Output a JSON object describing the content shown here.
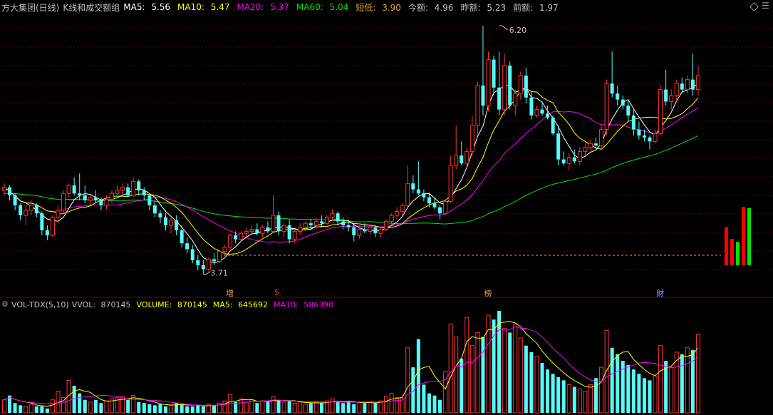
{
  "colors": {
    "up": "#ff3232",
    "down": "#54fcfc",
    "ma5": "#ffffff",
    "ma10": "#ffff00",
    "ma20": "#ff00ff",
    "ma60": "#00e600",
    "text": "#c0c0c0",
    "grid": "#800000",
    "low_line": "#c8a07a",
    "accent_orange": "#e0a040",
    "accent_blue": "#7aa2ff"
  },
  "header": {
    "stock_name": "方大集团(日线)",
    "indicator_name": "K线和成交额组",
    "ma5_label": "MA5:",
    "ma5_value": "5.56",
    "ma10_label": "MA10:",
    "ma10_value": "5.47",
    "ma20_label": "MA20:",
    "ma20_value": "5.37",
    "ma60_label": "MA60:",
    "ma60_value": "5.04",
    "short_low_label": "短低:",
    "short_low_value": "3.90",
    "today_amount_label": "今额:",
    "today_amount_value": "4.96",
    "yesterday_amount_label": "昨额:",
    "yesterday_amount_value": "5.23",
    "prev_amount_label": "前额:",
    "prev_amount_value": "1.97"
  },
  "volume_header": {
    "indicator": "VOL-TDX(5,10)",
    "vvol_label": "VVOL:",
    "vvol_value": "870145",
    "volume_label": "VOLUME:",
    "volume_value": "870145",
    "ma5_label": "MA5:",
    "ma5_value": "645692",
    "ma10_label": "MA10:",
    "ma10_value": "586390"
  },
  "annotations": {
    "high_label": "6.20",
    "low_label": "3.71",
    "event_markers": [
      {
        "label": "增",
        "index": 42,
        "color": "#e0a040"
      },
      {
        "label": "$",
        "index": 51,
        "color": "#ff3232"
      },
      {
        "label": "榜",
        "index": 90,
        "color": "#e0a040"
      },
      {
        "label": "财",
        "index": 122,
        "color": "#7aa2ff"
      }
    ]
  },
  "chart_data": {
    "type": "candlestick",
    "price_range": [
      3.6,
      6.3
    ],
    "low_reference": 3.9,
    "high_point": {
      "index": 92,
      "value": 6.2
    },
    "low_point": {
      "index": 37,
      "value": 3.71
    },
    "ohlc": [
      [
        4.55,
        4.62,
        4.5,
        4.58
      ],
      [
        4.58,
        4.6,
        4.45,
        4.5
      ],
      [
        4.5,
        4.52,
        4.35,
        4.4
      ],
      [
        4.4,
        4.42,
        4.25,
        4.3
      ],
      [
        4.3,
        4.4,
        4.2,
        4.35
      ],
      [
        4.35,
        4.45,
        4.3,
        4.4
      ],
      [
        4.4,
        4.42,
        4.28,
        4.32
      ],
      [
        4.32,
        4.34,
        4.1,
        4.15
      ],
      [
        4.15,
        4.2,
        4.05,
        4.1
      ],
      [
        4.1,
        4.3,
        4.08,
        4.28
      ],
      [
        4.28,
        4.4,
        4.22,
        4.35
      ],
      [
        4.35,
        4.55,
        4.32,
        4.52
      ],
      [
        4.52,
        4.62,
        4.48,
        4.6
      ],
      [
        4.6,
        4.68,
        4.5,
        4.52
      ],
      [
        4.52,
        4.72,
        4.45,
        4.5
      ],
      [
        4.5,
        4.6,
        4.42,
        4.45
      ],
      [
        4.45,
        4.5,
        4.4,
        4.48
      ],
      [
        4.48,
        4.55,
        4.42,
        4.45
      ],
      [
        4.45,
        4.48,
        4.35,
        4.4
      ],
      [
        4.4,
        4.5,
        4.36,
        4.46
      ],
      [
        4.46,
        4.55,
        4.42,
        4.52
      ],
      [
        4.52,
        4.6,
        4.48,
        4.55
      ],
      [
        4.55,
        4.62,
        4.5,
        4.58
      ],
      [
        4.58,
        4.62,
        4.48,
        4.5
      ],
      [
        4.5,
        4.68,
        4.48,
        4.64
      ],
      [
        4.64,
        4.66,
        4.5,
        4.55
      ],
      [
        4.55,
        4.58,
        4.45,
        4.5
      ],
      [
        4.5,
        4.52,
        4.35,
        4.4
      ],
      [
        4.4,
        4.45,
        4.28,
        4.32
      ],
      [
        4.32,
        4.35,
        4.22,
        4.28
      ],
      [
        4.28,
        4.32,
        4.15,
        4.2
      ],
      [
        4.2,
        4.28,
        4.12,
        4.25
      ],
      [
        4.25,
        4.3,
        4.1,
        4.15
      ],
      [
        4.15,
        4.2,
        3.98,
        4.02
      ],
      [
        4.02,
        4.08,
        3.92,
        3.96
      ],
      [
        3.96,
        4.0,
        3.82,
        3.85
      ],
      [
        3.85,
        3.9,
        3.75,
        3.8
      ],
      [
        3.8,
        3.85,
        3.71,
        3.76
      ],
      [
        3.76,
        3.88,
        3.74,
        3.86
      ],
      [
        3.86,
        3.92,
        3.8,
        3.84
      ],
      [
        3.84,
        3.96,
        3.82,
        3.94
      ],
      [
        3.94,
        4.0,
        3.9,
        3.98
      ],
      [
        3.98,
        4.12,
        3.96,
        4.1
      ],
      [
        4.1,
        4.14,
        4.02,
        4.06
      ],
      [
        4.06,
        4.14,
        4.04,
        4.12
      ],
      [
        4.12,
        4.18,
        4.08,
        4.14
      ],
      [
        4.14,
        4.2,
        4.1,
        4.16
      ],
      [
        4.16,
        4.22,
        4.1,
        4.12
      ],
      [
        4.12,
        4.2,
        4.08,
        4.18
      ],
      [
        4.18,
        4.24,
        4.12,
        4.14
      ],
      [
        4.14,
        4.5,
        4.12,
        4.3
      ],
      [
        4.3,
        4.34,
        4.1,
        4.14
      ],
      [
        4.14,
        4.22,
        4.08,
        4.2
      ],
      [
        4.2,
        4.26,
        4.02,
        4.06
      ],
      [
        4.06,
        4.16,
        4.02,
        4.14
      ],
      [
        4.14,
        4.22,
        4.1,
        4.18
      ],
      [
        4.18,
        4.24,
        4.14,
        4.22
      ],
      [
        4.22,
        4.26,
        4.16,
        4.2
      ],
      [
        4.2,
        4.28,
        4.18,
        4.24
      ],
      [
        4.24,
        4.3,
        4.18,
        4.22
      ],
      [
        4.22,
        4.3,
        4.2,
        4.28
      ],
      [
        4.28,
        4.36,
        4.24,
        4.32
      ],
      [
        4.32,
        4.34,
        4.2,
        4.24
      ],
      [
        4.24,
        4.28,
        4.16,
        4.2
      ],
      [
        4.2,
        4.26,
        4.14,
        4.18
      ],
      [
        4.18,
        4.22,
        4.04,
        4.1
      ],
      [
        4.1,
        4.2,
        4.06,
        4.16
      ],
      [
        4.16,
        4.22,
        4.12,
        4.14
      ],
      [
        4.14,
        4.2,
        4.1,
        4.18
      ],
      [
        4.18,
        4.2,
        4.08,
        4.12
      ],
      [
        4.12,
        4.18,
        4.08,
        4.16
      ],
      [
        4.16,
        4.26,
        4.14,
        4.24
      ],
      [
        4.24,
        4.32,
        4.2,
        4.3
      ],
      [
        4.3,
        4.38,
        4.26,
        4.34
      ],
      [
        4.34,
        4.42,
        4.3,
        4.4
      ],
      [
        4.4,
        4.8,
        4.38,
        4.62
      ],
      [
        4.62,
        4.7,
        4.52,
        4.56
      ],
      [
        4.56,
        4.84,
        4.5,
        4.52
      ],
      [
        4.52,
        4.56,
        4.44,
        4.48
      ],
      [
        4.48,
        4.52,
        4.38,
        4.42
      ],
      [
        4.42,
        4.48,
        4.36,
        4.38
      ],
      [
        4.38,
        4.4,
        4.26,
        4.32
      ],
      [
        4.32,
        4.45,
        4.3,
        4.44
      ],
      [
        4.44,
        4.9,
        4.42,
        4.8
      ],
      [
        4.8,
        5.2,
        4.76,
        4.9
      ],
      [
        4.9,
        5.04,
        4.8,
        4.82
      ],
      [
        4.82,
        4.98,
        4.78,
        4.94
      ],
      [
        4.94,
        5.3,
        4.9,
        5.2
      ],
      [
        5.2,
        5.64,
        5.1,
        5.6
      ],
      [
        5.6,
        6.2,
        5.3,
        5.4
      ],
      [
        5.4,
        5.94,
        5.34,
        5.86
      ],
      [
        5.86,
        5.9,
        5.5,
        5.58
      ],
      [
        5.58,
        5.94,
        5.3,
        5.36
      ],
      [
        5.36,
        5.92,
        5.3,
        5.8
      ],
      [
        5.8,
        5.84,
        5.36,
        5.4
      ],
      [
        5.4,
        5.56,
        5.3,
        5.52
      ],
      [
        5.52,
        5.74,
        5.46,
        5.7
      ],
      [
        5.7,
        5.78,
        5.42,
        5.48
      ],
      [
        5.48,
        5.54,
        5.26,
        5.3
      ],
      [
        5.3,
        5.4,
        5.28,
        5.36
      ],
      [
        5.36,
        5.44,
        5.3,
        5.32
      ],
      [
        5.32,
        5.4,
        5.26,
        5.28
      ],
      [
        5.28,
        5.3,
        5.1,
        5.12
      ],
      [
        5.12,
        5.2,
        4.8,
        4.86
      ],
      [
        4.86,
        4.94,
        4.8,
        4.82
      ],
      [
        4.82,
        4.92,
        4.76,
        4.88
      ],
      [
        4.88,
        4.96,
        4.82,
        4.84
      ],
      [
        4.84,
        4.98,
        4.8,
        4.94
      ],
      [
        4.94,
        5.02,
        4.9,
        4.98
      ],
      [
        4.98,
        5.06,
        4.94,
        5.02
      ],
      [
        5.02,
        5.08,
        4.96,
        5.0
      ],
      [
        5.0,
        5.2,
        4.98,
        5.16
      ],
      [
        5.16,
        5.66,
        5.1,
        5.62
      ],
      [
        5.62,
        5.94,
        5.48,
        5.52
      ],
      [
        5.52,
        5.6,
        5.4,
        5.46
      ],
      [
        5.46,
        5.5,
        5.36,
        5.4
      ],
      [
        5.4,
        5.46,
        5.24,
        5.3
      ],
      [
        5.3,
        5.36,
        5.1,
        5.16
      ],
      [
        5.16,
        5.24,
        5.06,
        5.1
      ],
      [
        5.1,
        5.16,
        5.04,
        5.08
      ],
      [
        5.08,
        5.1,
        4.96,
        5.04
      ],
      [
        5.04,
        5.16,
        5.02,
        5.12
      ],
      [
        5.12,
        5.6,
        5.1,
        5.56
      ],
      [
        5.56,
        5.76,
        5.4,
        5.44
      ],
      [
        5.44,
        5.56,
        5.36,
        5.5
      ],
      [
        5.5,
        5.66,
        5.44,
        5.62
      ],
      [
        5.62,
        5.68,
        5.52,
        5.56
      ],
      [
        5.56,
        5.7,
        5.52,
        5.66
      ],
      [
        5.66,
        5.92,
        5.5,
        5.56
      ],
      [
        5.56,
        5.8,
        5.5,
        5.7
      ]
    ],
    "volume": [
      120,
      160,
      90,
      70,
      60,
      80,
      60,
      60,
      40,
      120,
      200,
      140,
      300,
      250,
      180,
      120,
      100,
      120,
      90,
      110,
      130,
      140,
      150,
      120,
      160,
      100,
      90,
      80,
      70,
      80,
      60,
      70,
      90,
      80,
      60,
      60,
      70,
      60,
      80,
      70,
      90,
      110,
      170,
      100,
      130,
      100,
      120,
      90,
      110,
      100,
      150,
      110,
      100,
      110,
      90,
      100,
      80,
      90,
      100,
      90,
      110,
      130,
      100,
      90,
      110,
      80,
      100,
      90,
      100,
      90,
      110,
      150,
      180,
      140,
      130,
      600,
      420,
      680,
      260,
      180,
      160,
      120,
      380,
      820,
      700,
      500,
      880,
      620,
      740,
      700,
      900,
      860,
      940,
      780,
      740,
      820,
      690,
      620,
      560,
      520,
      460,
      400,
      360,
      330,
      300,
      260,
      240,
      220,
      200,
      260,
      320,
      420,
      760,
      600,
      540,
      480,
      440,
      400,
      360,
      320,
      300,
      340,
      620,
      480,
      420,
      560,
      540,
      600,
      580,
      720
    ],
    "right_bars": [
      {
        "value": 0.65,
        "color": "red"
      },
      {
        "value": 0.45,
        "color": "red"
      },
      {
        "value": 0.4,
        "color": "green"
      },
      {
        "value": 1.0,
        "color": "red"
      },
      {
        "value": 0.98,
        "color": "green"
      }
    ]
  }
}
